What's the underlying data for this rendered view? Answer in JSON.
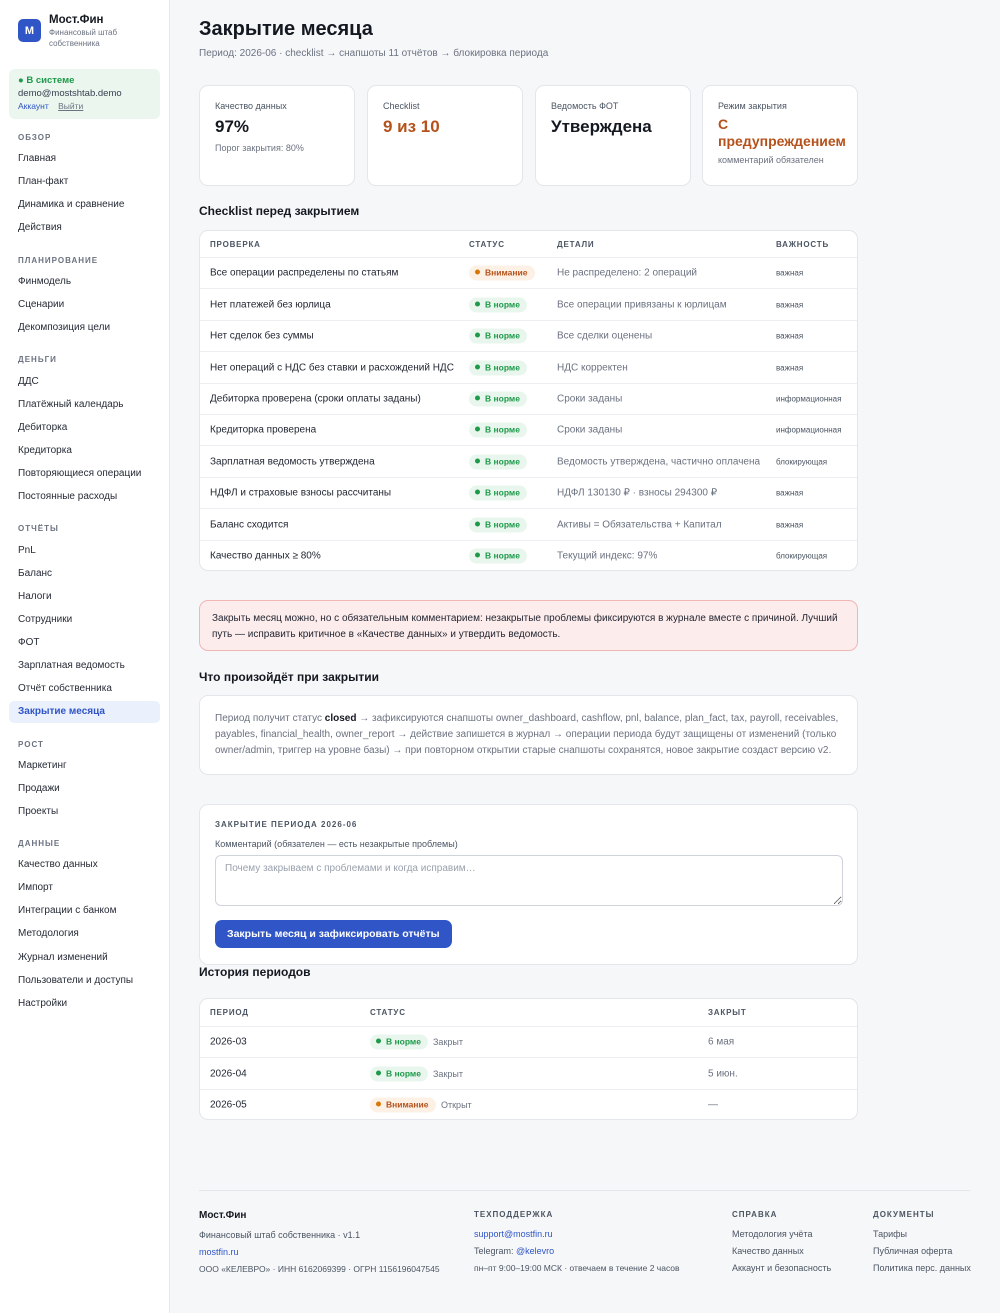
{
  "brand": {
    "logo_letter": "М",
    "name": "Мост.Фин",
    "subtitle": "Финансовый штаб собственника"
  },
  "auth": {
    "status": "● В системе",
    "email": "demo@mostshtab.demo",
    "account_link": "Аккаунт",
    "logout_link": "Выйти"
  },
  "nav": {
    "overview": {
      "title": "ОБЗОР",
      "items": [
        "Главная",
        "План-факт",
        "Динамика и сравнение",
        "Действия"
      ]
    },
    "planning": {
      "title": "ПЛАНИРОВАНИЕ",
      "items": [
        "Финмодель",
        "Сценарии",
        "Декомпозиция цели"
      ]
    },
    "money": {
      "title": "ДЕНЬГИ",
      "items": [
        "ДДС",
        "Платёжный календарь",
        "Дебиторка",
        "Кредиторка",
        "Повторяющиеся операции",
        "Постоянные расходы"
      ]
    },
    "reports": {
      "title": "ОТЧЁТЫ",
      "items": [
        "PnL",
        "Баланс",
        "Налоги",
        "Сотрудники",
        "ФОТ",
        "Зарплатная ведомость",
        "Отчёт собственника",
        "Закрытие месяца"
      ]
    },
    "growth": {
      "title": "РОСТ",
      "items": [
        "Маркетинг",
        "Продажи",
        "Проекты"
      ]
    },
    "data": {
      "title": "ДАННЫЕ",
      "items": [
        "Качество данных",
        "Импорт",
        "Интеграции с банком",
        "Методология",
        "Журнал изменений",
        "Пользователи и доступы",
        "Настройки"
      ]
    },
    "active_item": "Закрытие месяца"
  },
  "header": {
    "title": "Закрытие месяца",
    "subtitle": "Период: 2026-06 · checklist → снапшоты 11 отчётов → блокировка периода"
  },
  "kpis": [
    {
      "label": "Качество данных",
      "value": "97%",
      "note": "Порог закрытия: 80%"
    },
    {
      "label": "Checklist",
      "value": "9 из 10",
      "note": ""
    },
    {
      "label": "Ведомость ФОТ",
      "value": "Утверждена",
      "note": ""
    },
    {
      "label": "Режим закрытия",
      "value": "С предупреждением",
      "note": "комментарий обязателен"
    }
  ],
  "checklist": {
    "title": "Checklist перед закрытием",
    "headers": [
      "ПРОВЕРКА",
      "СТАТУС",
      "ДЕТАЛИ",
      "ВАЖНОСТЬ"
    ],
    "rows": [
      {
        "check": "Все операции распределены по статьям",
        "status": "Внимание",
        "status_kind": "warn",
        "details": "Не распределено: 2 операций",
        "importance": "важная"
      },
      {
        "check": "Нет платежей без юрлица",
        "status": "В норме",
        "status_kind": "ok",
        "details": "Все операции привязаны к юрлицам",
        "importance": "важная"
      },
      {
        "check": "Нет сделок без суммы",
        "status": "В норме",
        "status_kind": "ok",
        "details": "Все сделки оценены",
        "importance": "важная"
      },
      {
        "check": "Нет операций с НДС без ставки и расхождений НДС",
        "status": "В норме",
        "status_kind": "ok",
        "details": "НДС корректен",
        "importance": "важная"
      },
      {
        "check": "Дебиторка проверена (сроки оплаты заданы)",
        "status": "В норме",
        "status_kind": "ok",
        "details": "Сроки заданы",
        "importance": "информационная"
      },
      {
        "check": "Кредиторка проверена",
        "status": "В норме",
        "status_kind": "ok",
        "details": "Сроки заданы",
        "importance": "информационная"
      },
      {
        "check": "Зарплатная ведомость утверждена",
        "status": "В норме",
        "status_kind": "ok",
        "details": "Ведомость утверждена, частично оплачена",
        "importance": "блокирующая"
      },
      {
        "check": "НДФЛ и страховые взносы рассчитаны",
        "status": "В норме",
        "status_kind": "ok",
        "details": "НДФЛ 130130 ₽ · взносы 294300 ₽",
        "importance": "важная"
      },
      {
        "check": "Баланс сходится",
        "status": "В норме",
        "status_kind": "ok",
        "details": "Активы = Обязательства + Капитал",
        "importance": "важная"
      },
      {
        "check": "Качество данных ≥ 80%",
        "status": "В норме",
        "status_kind": "ok",
        "details": "Текущий индекс: 97%",
        "importance": "блокирующая"
      }
    ]
  },
  "alert": {
    "text": "Закрыть месяц можно, но с обязательным комментарием: незакрытые проблемы фиксируются в журнале вместе с причиной. Лучший путь — исправить критичное в «Качестве данных» и утвердить ведомость."
  },
  "what_happens": {
    "title": "Что произойдёт при закрытии",
    "text_before": "Период получит статус ",
    "bold": "closed",
    "text_after": " → зафиксируются снапшоты owner_dashboard, cashflow, pnl, balance, plan_fact, tax, payroll, receivables, payables, financial_health, owner_report → действие запишется в журнал → операции периода будут защищены от изменений (только owner/admin, триггер на уровне базы) → при повторном открытии старые снапшоты сохранятся, новое закрытие создаст версию v2."
  },
  "close_form": {
    "title": "ЗАКРЫТИЕ ПЕРИОДА 2026-06",
    "comment_label": "Комментарий (обязателен — есть незакрытые проблемы)",
    "comment_placeholder": "Почему закрываем с проблемами и когда исправим…",
    "comment_value": "",
    "submit_label": "Закрыть месяц и зафиксировать отчёты"
  },
  "history": {
    "title": "История периодов",
    "headers": [
      "ПЕРИОД",
      "СТАТУС",
      "ЗАКРЫТ"
    ],
    "rows": [
      {
        "period": "2026-03",
        "status": "В норме",
        "status_kind": "ok",
        "state": "Закрыт",
        "closed": "6 мая"
      },
      {
        "period": "2026-04",
        "status": "В норме",
        "status_kind": "ok",
        "state": "Закрыт",
        "closed": "5 июн."
      },
      {
        "period": "2026-05",
        "status": "Внимание",
        "status_kind": "warn",
        "state": "Открыт",
        "closed": "—"
      }
    ]
  },
  "footer": {
    "brand": {
      "name": "Мост.Фин",
      "tagline": "Финансовый штаб собственника · v1.1",
      "site": "mostfin.ru",
      "legal": "ООО «КЕЛЕВРО» · ИНН 6162069399 · ОГРН 1156196047545"
    },
    "support": {
      "title": "ТЕХПОДДЕРЖКА",
      "email": "support@mostfin.ru",
      "telegram_label": "Telegram: ",
      "telegram_handle": "@kelevro",
      "hours": "пн–пт 9:00–19:00 МСК · отвечаем в течение 2 часов"
    },
    "help": {
      "title": "СПРАВКА",
      "items": [
        "Методология учёта",
        "Качество данных",
        "Аккаунт и безопасность"
      ]
    },
    "docs": {
      "title": "ДОКУМЕНТЫ",
      "items": [
        "Тарифы",
        "Публичная оферта",
        "Политика перс. данных"
      ]
    }
  },
  "colors": {
    "accent": "#2f55c6",
    "ok": "#1e9a4a",
    "warn": "#b5521b",
    "alert_bg": "#fdecec"
  }
}
